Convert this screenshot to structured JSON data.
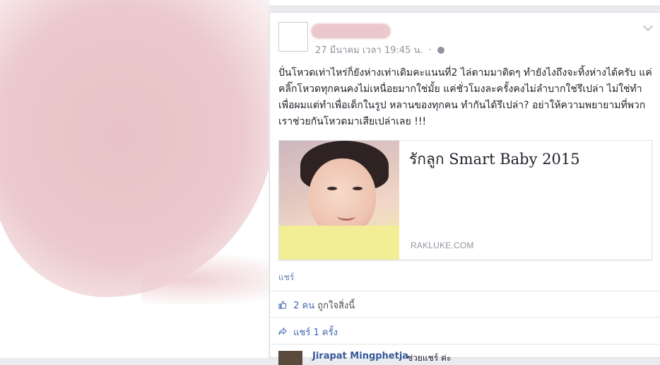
{
  "post": {
    "timestamp": "27 มีนาคม เวลา 19:45 น.",
    "separator": "·",
    "body": "ปั่นโหวดเท่าไหร่ก็ยังห่างเท่าเดิมคะแนนที่2 ไล่ตามมาติดๆ ทำยังไงถึงจะทิ้งห่างได้ครับ แค่คลิ๊กโหวดทุกคนคงไม่เหนื่อยมากใช่มั้ย แค่ชั่วโมงละครั้งคงไม่ลำบากใช่รึเปล่า ไม่ใช่ทำเพื่อผมแต่ทำเพื่อเด็กในรูป หลานของทุกคน ทำกันได้รึเปล่า? อย่าให้ความพยายามที่พวกเราช่วยกันโหวดมาเสียเปล่าเลย !!!",
    "link_card": {
      "title": "รักลูก Smart Baby 2015",
      "domain": "RAKLUKE.COM"
    },
    "share_label": "แชร์",
    "likes": {
      "count": "2 คน",
      "suffix": "ถูกใจสิ่งนี้"
    },
    "shares": {
      "label": "แชร์",
      "count": "1 ครั้ง"
    },
    "comment": {
      "author": "Jirapat Mingphetja",
      "text": "ช่วยแชร์ ค่ะ"
    }
  },
  "colors": {
    "link_blue": "#4267b2",
    "meta_gray": "#90949c"
  }
}
